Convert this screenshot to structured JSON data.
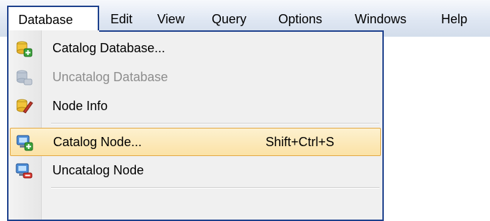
{
  "menubar": {
    "items": [
      {
        "label": "Database",
        "active": true
      },
      {
        "label": "Edit"
      },
      {
        "label": "View"
      },
      {
        "label": "Query"
      },
      {
        "label": "Options"
      },
      {
        "label": "Windows"
      },
      {
        "label": "Help"
      }
    ]
  },
  "menu": {
    "items": [
      {
        "label": "Catalog Database...",
        "icon": "database-add-icon"
      },
      {
        "label": "Uncatalog Database",
        "icon": "database-remove-icon",
        "disabled": true
      },
      {
        "label": "Node Info",
        "icon": "database-edit-icon"
      },
      {
        "label": "Catalog Node...",
        "icon": "node-add-icon",
        "shortcut": "Shift+Ctrl+S",
        "selected": true
      },
      {
        "label": "Uncatalog Node",
        "icon": "node-remove-icon"
      }
    ]
  },
  "colors": {
    "menubar_gradient_top": "#f6f8fc",
    "menubar_gradient_bottom": "#d3ddeb",
    "menu_border": "#1b3f8c",
    "selection_fill": "#fbe2a6",
    "selection_border": "#e3a740",
    "disabled_text": "#8d8d8d"
  }
}
